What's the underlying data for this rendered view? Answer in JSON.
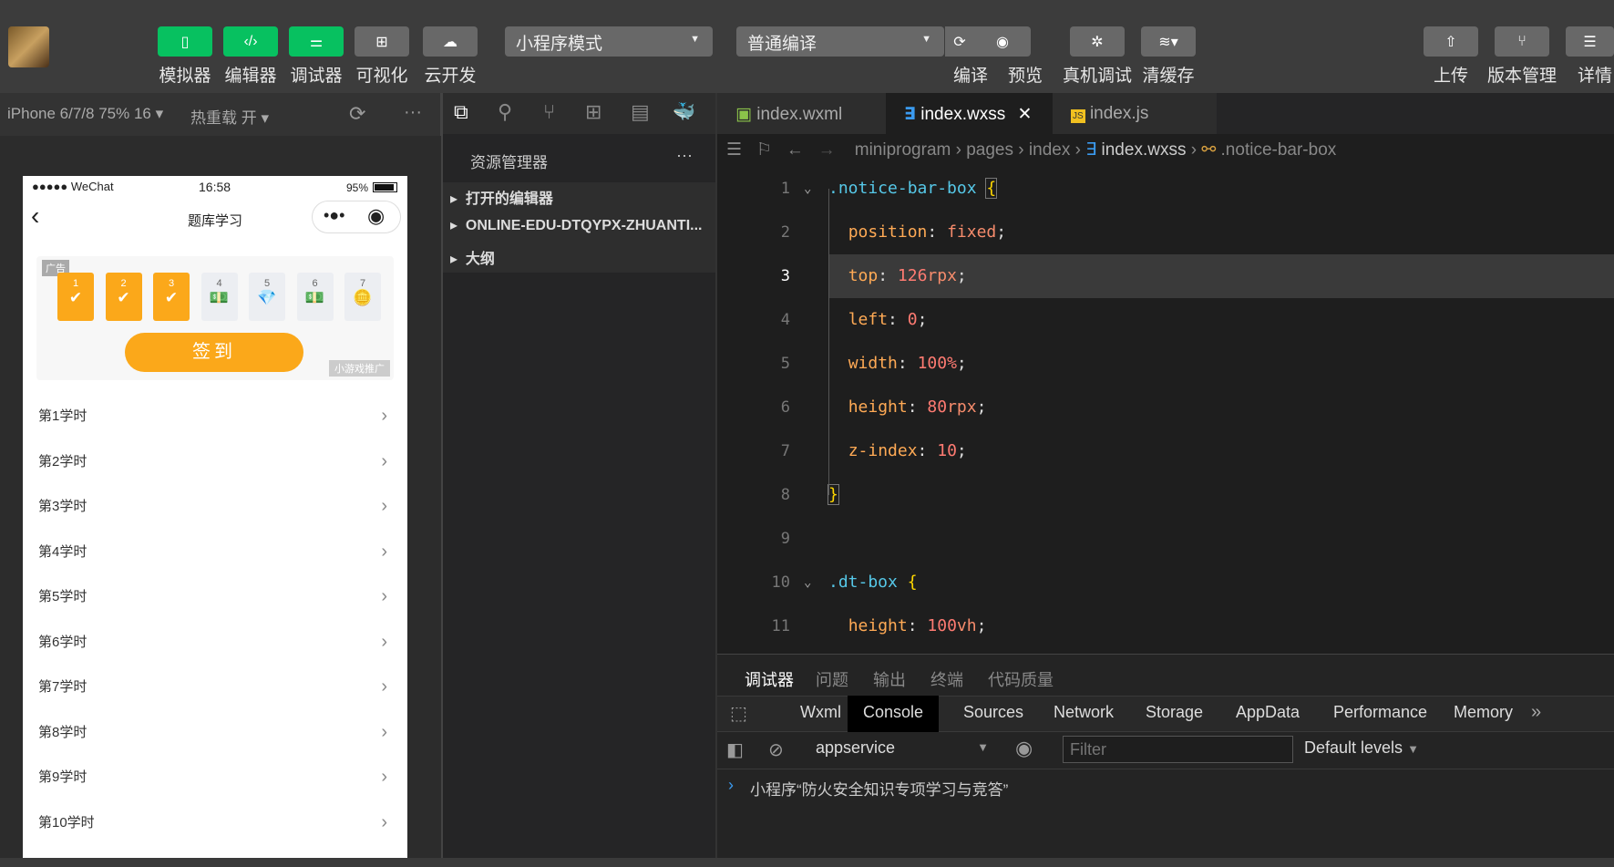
{
  "toolbar": {
    "left_buttons": [
      {
        "label": "模拟器",
        "icon": "phone-icon"
      },
      {
        "label": "编辑器",
        "icon": "code-icon"
      },
      {
        "label": "调试器",
        "icon": "debug-sliders-icon"
      },
      {
        "label": "可视化",
        "icon": "layout-icon"
      },
      {
        "label": "云开发",
        "icon": "cloud-icon"
      }
    ],
    "mode_select": "小程序模式",
    "compile_select": "普通编译",
    "mid_buttons": [
      {
        "label": "编译",
        "icon": "refresh-icon"
      },
      {
        "label": "预览",
        "icon": "eye-icon"
      },
      {
        "label": "真机调试",
        "icon": "bug-icon"
      },
      {
        "label": "清缓存",
        "icon": "layers-icon"
      }
    ],
    "right_buttons": [
      {
        "label": "上传",
        "icon": "upload-icon"
      },
      {
        "label": "版本管理",
        "icon": "branch-icon"
      },
      {
        "label": "详情",
        "icon": "menu-icon"
      }
    ]
  },
  "simulator": {
    "device": "iPhone 6/7/8 75% 16 ▾",
    "hot_reload": "热重载 开 ▾",
    "status_bar": {
      "carrier": "●●●●● WeChat",
      "time": "16:58",
      "battery": "95%"
    },
    "nav_title": "题库学习",
    "ad_label": "广告",
    "days": [
      {
        "n": "1",
        "done": true
      },
      {
        "n": "2",
        "done": true
      },
      {
        "n": "3",
        "done": true
      },
      {
        "n": "4",
        "done": false
      },
      {
        "n": "5",
        "done": false
      },
      {
        "n": "6",
        "done": false
      },
      {
        "n": "7",
        "done": false
      }
    ],
    "checkin_button": "签到",
    "promo_label": "小游戏推广",
    "lessons": [
      "第1学时",
      "第2学时",
      "第3学时",
      "第4学时",
      "第5学时",
      "第6学时",
      "第7学时",
      "第8学时",
      "第9学时",
      "第10学时"
    ]
  },
  "explorer": {
    "title": "资源管理器",
    "sections": [
      "打开的编辑器",
      "ONLINE-EDU-DTQYPX-ZHUANTI...",
      "大纲"
    ]
  },
  "editor": {
    "tabs": [
      "index.wxml",
      "index.wxss",
      "index.js"
    ],
    "active_tab": 1,
    "breadcrumb": [
      "miniprogram",
      "pages",
      "index",
      "index.wxss",
      ".notice-bar-box"
    ],
    "current_line": 3
  },
  "bottom_panel": {
    "tabs": [
      "调试器",
      "问题",
      "输出",
      "终端",
      "代码质量"
    ],
    "devtools_tabs": [
      "Wxml",
      "Console",
      "Sources",
      "Network",
      "Storage",
      "AppData",
      "Performance",
      "Memory"
    ],
    "context": "appservice",
    "filter_placeholder": "Filter",
    "levels": "Default levels",
    "console_message": "小程序“防火安全知识专项学习与竞答”"
  }
}
